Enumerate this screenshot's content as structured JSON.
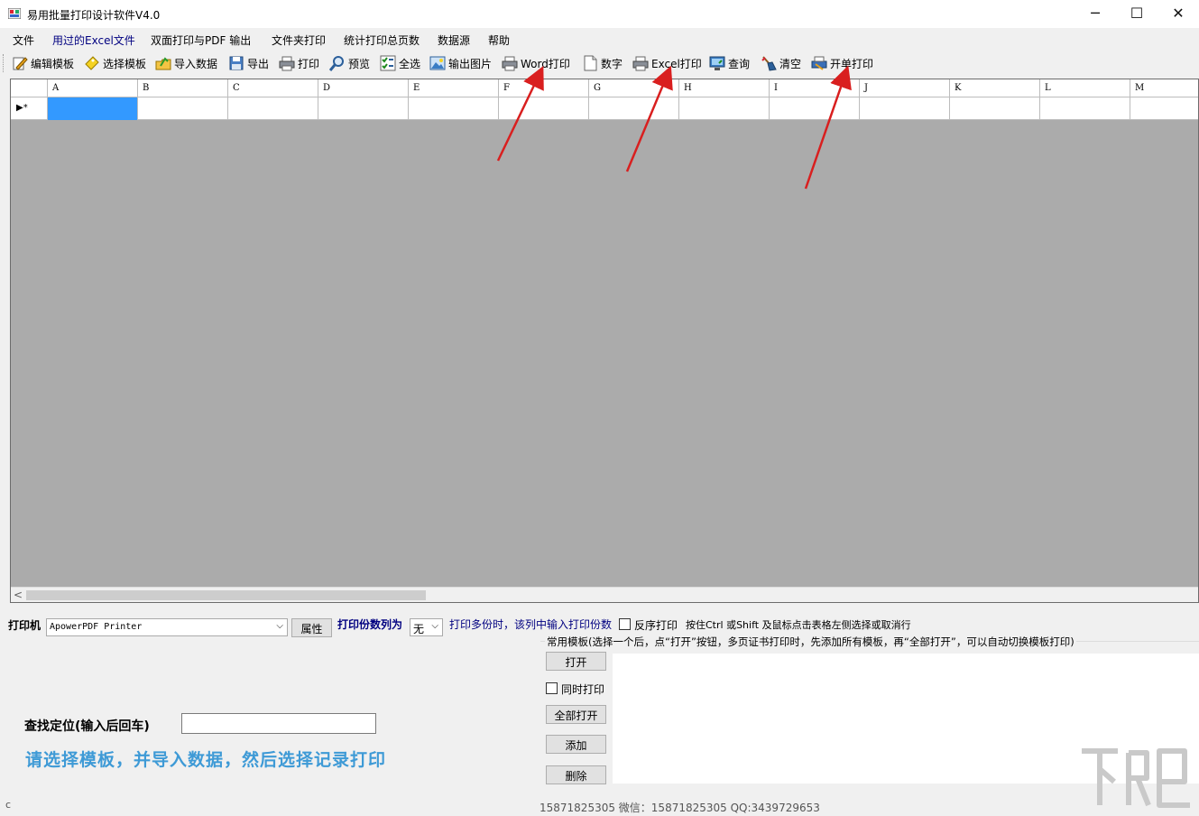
{
  "window": {
    "title": "易用批量打印设计软件V4.0",
    "minimize": "─",
    "maximize": "☐",
    "close": "✕"
  },
  "menu": [
    {
      "label": "文件"
    },
    {
      "label": "用过的Excel文件"
    },
    {
      "label": "双面打印与PDF 输出"
    },
    {
      "label": "文件夹打印"
    },
    {
      "label": "统计打印总页数"
    },
    {
      "label": "数据源"
    },
    {
      "label": "帮助"
    }
  ],
  "toolbar": [
    {
      "label": "编辑模板",
      "icon": "edit-template-icon"
    },
    {
      "label": "选择模板",
      "icon": "select-template-icon"
    },
    {
      "label": "导入数据",
      "icon": "import-data-icon"
    },
    {
      "label": "导出",
      "icon": "export-icon"
    },
    {
      "label": "打印",
      "icon": "printer-icon"
    },
    {
      "label": "预览",
      "icon": "magnifier-icon"
    },
    {
      "label": "全选",
      "icon": "select-all-icon"
    },
    {
      "label": "输出图片",
      "icon": "picture-icon"
    },
    {
      "label": "Word打印",
      "icon": "printer-icon"
    },
    {
      "label": "数字",
      "icon": "document-icon"
    },
    {
      "label": "Excel打印",
      "icon": "printer-icon"
    },
    {
      "label": "查询",
      "icon": "monitor-icon"
    },
    {
      "label": "清空",
      "icon": "broom-icon"
    },
    {
      "label": "开单打印",
      "icon": "print-bill-icon"
    }
  ],
  "grid": {
    "columns": [
      "A",
      "B",
      "C",
      "D",
      "E",
      "F",
      "G",
      "H",
      "I",
      "J",
      "K",
      "L",
      "M"
    ],
    "row_marker": "▶*"
  },
  "printer": {
    "label": "打印机",
    "value": "ApowerPDF Printer",
    "properties_button": "属性",
    "copies_label": "打印份数列为",
    "copies_value": "无",
    "copies_hint": "打印多份时，该列中输入打印份数",
    "reverse_label": "反序打印",
    "select_hint": "按住Ctrl 或Shift 及鼠标点击表格左侧选择或取消行"
  },
  "templates": {
    "group_title": "常用模板(选择一个后，点“打开”按钮，多页证书打印时，先添加所有模板，再“全部打开”，可以自动切换模板打印)",
    "open_button": "打开",
    "simultaneous_label": "同时打印",
    "open_all_button": "全部打开",
    "add_button": "添加",
    "delete_button": "删除"
  },
  "search": {
    "label": "查找定位(输入后回车)",
    "value": ""
  },
  "hint": "请选择模板，并导入数据，然后选择记录打印",
  "status": {
    "contact": "15871825305    微信：15871825305    QQ:3439729653",
    "left_mark": "c"
  },
  "colors": {
    "selection": "#3399ff",
    "grid_background": "#ababab",
    "hint_text": "#3e9ad6",
    "label_blue": "#000080",
    "arrow": "#d91f1f"
  }
}
